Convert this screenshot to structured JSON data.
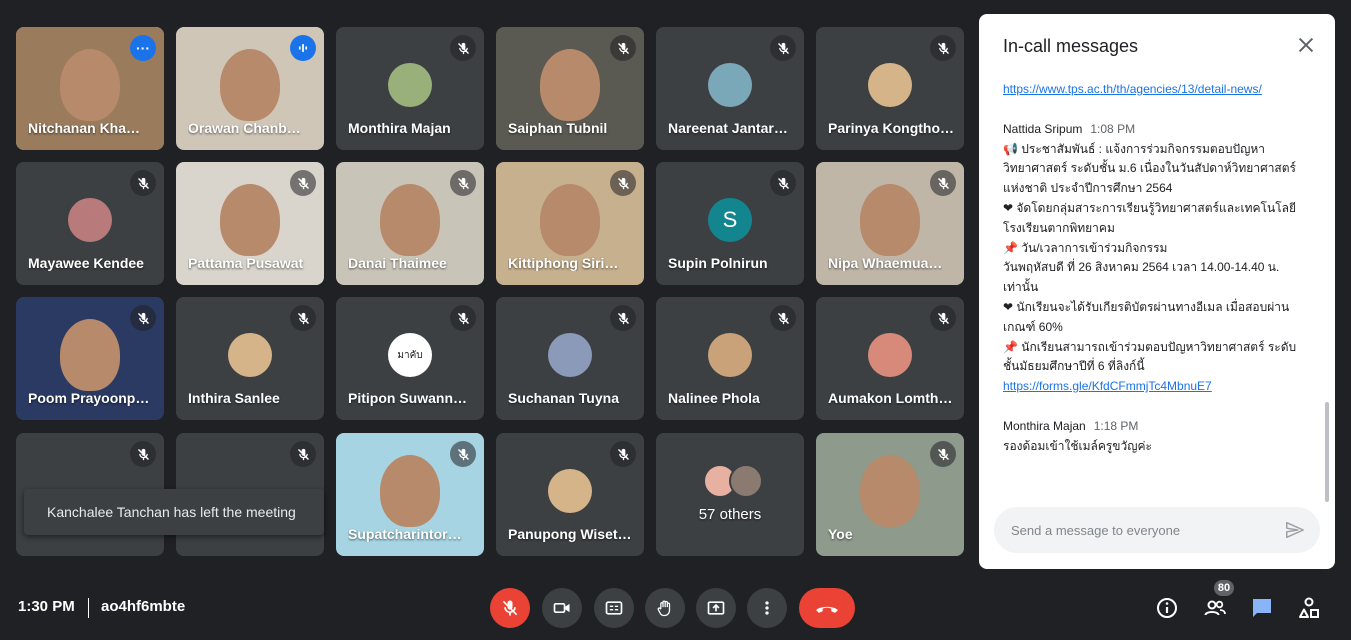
{
  "participants": [
    {
      "name": "Nitchanan Kha…",
      "bg": "#9a7b5c",
      "muted": false,
      "badge": "···",
      "active": true
    },
    {
      "name": "Orawan Chanb…",
      "bg": "#cfc6b8",
      "muted": false,
      "badge": "speaking",
      "active": false
    },
    {
      "name": "Monthira Majan",
      "bg": "#3c4043",
      "muted": true,
      "avatar": "photo"
    },
    {
      "name": "Saiphan Tubnil",
      "bg": "#5a5a52",
      "muted": true
    },
    {
      "name": "Nareenat Jantar…",
      "bg": "#3c4043",
      "muted": true,
      "avatar": "photo"
    },
    {
      "name": "Parinya Kongtho…",
      "bg": "#3c4043",
      "muted": true,
      "avatar": "photo"
    },
    {
      "name": "Mayawee Kendee",
      "bg": "#3c4043",
      "muted": true,
      "avatar": "photo"
    },
    {
      "name": "Pattama Pusawat",
      "bg": "#d9d4cc",
      "muted": true
    },
    {
      "name": "Danai Thaimee",
      "bg": "#c9c4b8",
      "muted": true
    },
    {
      "name": "Kittiphong Siri…",
      "bg": "#c7b08e",
      "muted": true
    },
    {
      "name": "Supin Polnirun",
      "bg": "#3c4043",
      "muted": true,
      "avatar": "letter",
      "letter": "S"
    },
    {
      "name": "Nipa Whaemua…",
      "bg": "#bfb6a8",
      "muted": true
    },
    {
      "name": "Poom Prayoonp…",
      "bg": "#2b3a63",
      "muted": true
    },
    {
      "name": "Inthira Sanlee",
      "bg": "#3c4043",
      "muted": true,
      "avatar": "photo"
    },
    {
      "name": "Pitipon Suwanna…",
      "bg": "#3c4043",
      "muted": true,
      "avatar": "text",
      "avatar_text": "มาคับ"
    },
    {
      "name": "Suchanan Tuyna",
      "bg": "#3c4043",
      "muted": true,
      "avatar": "photo"
    },
    {
      "name": "Nalinee Phola",
      "bg": "#3c4043",
      "muted": true,
      "avatar": "photo"
    },
    {
      "name": "Aumakon Lomth…",
      "bg": "#3c4043",
      "muted": true,
      "avatar": "photo"
    },
    {
      "name": "",
      "bg": "#3c4043",
      "muted": true
    },
    {
      "name": "",
      "bg": "#3c4043",
      "muted": true
    },
    {
      "name": "Supatcharintor…",
      "bg": "#a6d4e2",
      "muted": true
    },
    {
      "name": "Panupong Wiset…",
      "bg": "#3c4043",
      "muted": true,
      "avatar": "photo"
    },
    {
      "name": "57 others",
      "bg": "#3c4043",
      "muted": false,
      "others": true
    },
    {
      "name": "Yoe",
      "bg": "#8e9a8c",
      "muted": true
    }
  ],
  "toast": "Kanchalee Tanchan has left the meeting",
  "chat": {
    "title": "In-call messages",
    "link1": "https://www.tps.ac.th/th/agencies/13/detail-news/",
    "m1_sender": "Nattida Sripum",
    "m1_time": "1:08 PM",
    "m1_lines": [
      "📢 ประชาสัมพันธ์ :  แจ้งการร่วมกิจกรรมตอบปัญหา",
      "วิทยาศาสตร์ ระดับชั้น ม.6  เนื่องในวันสัปดาห์วิทยาศาสตร์",
      "แห่งชาติ ประจำปีการศึกษา 2564",
      "❤ จัดโดยกลุ่มสาระการเรียนรู้วิทยาศาสตร์และเทคโนโลยี",
      "โรงเรียนตากพิทยาคม",
      "📌  วัน/เวลาการเข้าร่วมกิจกรรม",
      "วันพฤหัสบดี ที่ 26 สิงหาคม 2564  เวลา 14.00-14.40 น.",
      "เท่านั้น",
      "❤ นักเรียนจะได้รับเกียรติบัตรผ่านทางอีเมล  เมื่อสอบผ่าน",
      "เกณฑ์ 60%",
      "📌 นักเรียนสามารถเข้าร่วมตอบปัญหาวิทยาศาสตร์ ระดับ",
      "ชั้นมัธยมศึกษาปีที่ 6 ที่ลิงก์นี้"
    ],
    "m1_link": "https://forms.gle/KfdCFmmjTc4MbnuE7",
    "m2_sender": "Monthira Majan",
    "m2_time": "1:18 PM",
    "m2_text": "รองด้อมเข้าใช้เมล์ครูขวัญค่ะ",
    "placeholder": "Send a message to everyone"
  },
  "bottom": {
    "time": "1:30 PM",
    "code": "ao4hf6mbte",
    "people_count": "80"
  },
  "colors": {
    "accent": "#8ab4f8",
    "red": "#ea4335",
    "link": "#1a73e8",
    "tile": "#3c4043",
    "bg": "#202124"
  }
}
